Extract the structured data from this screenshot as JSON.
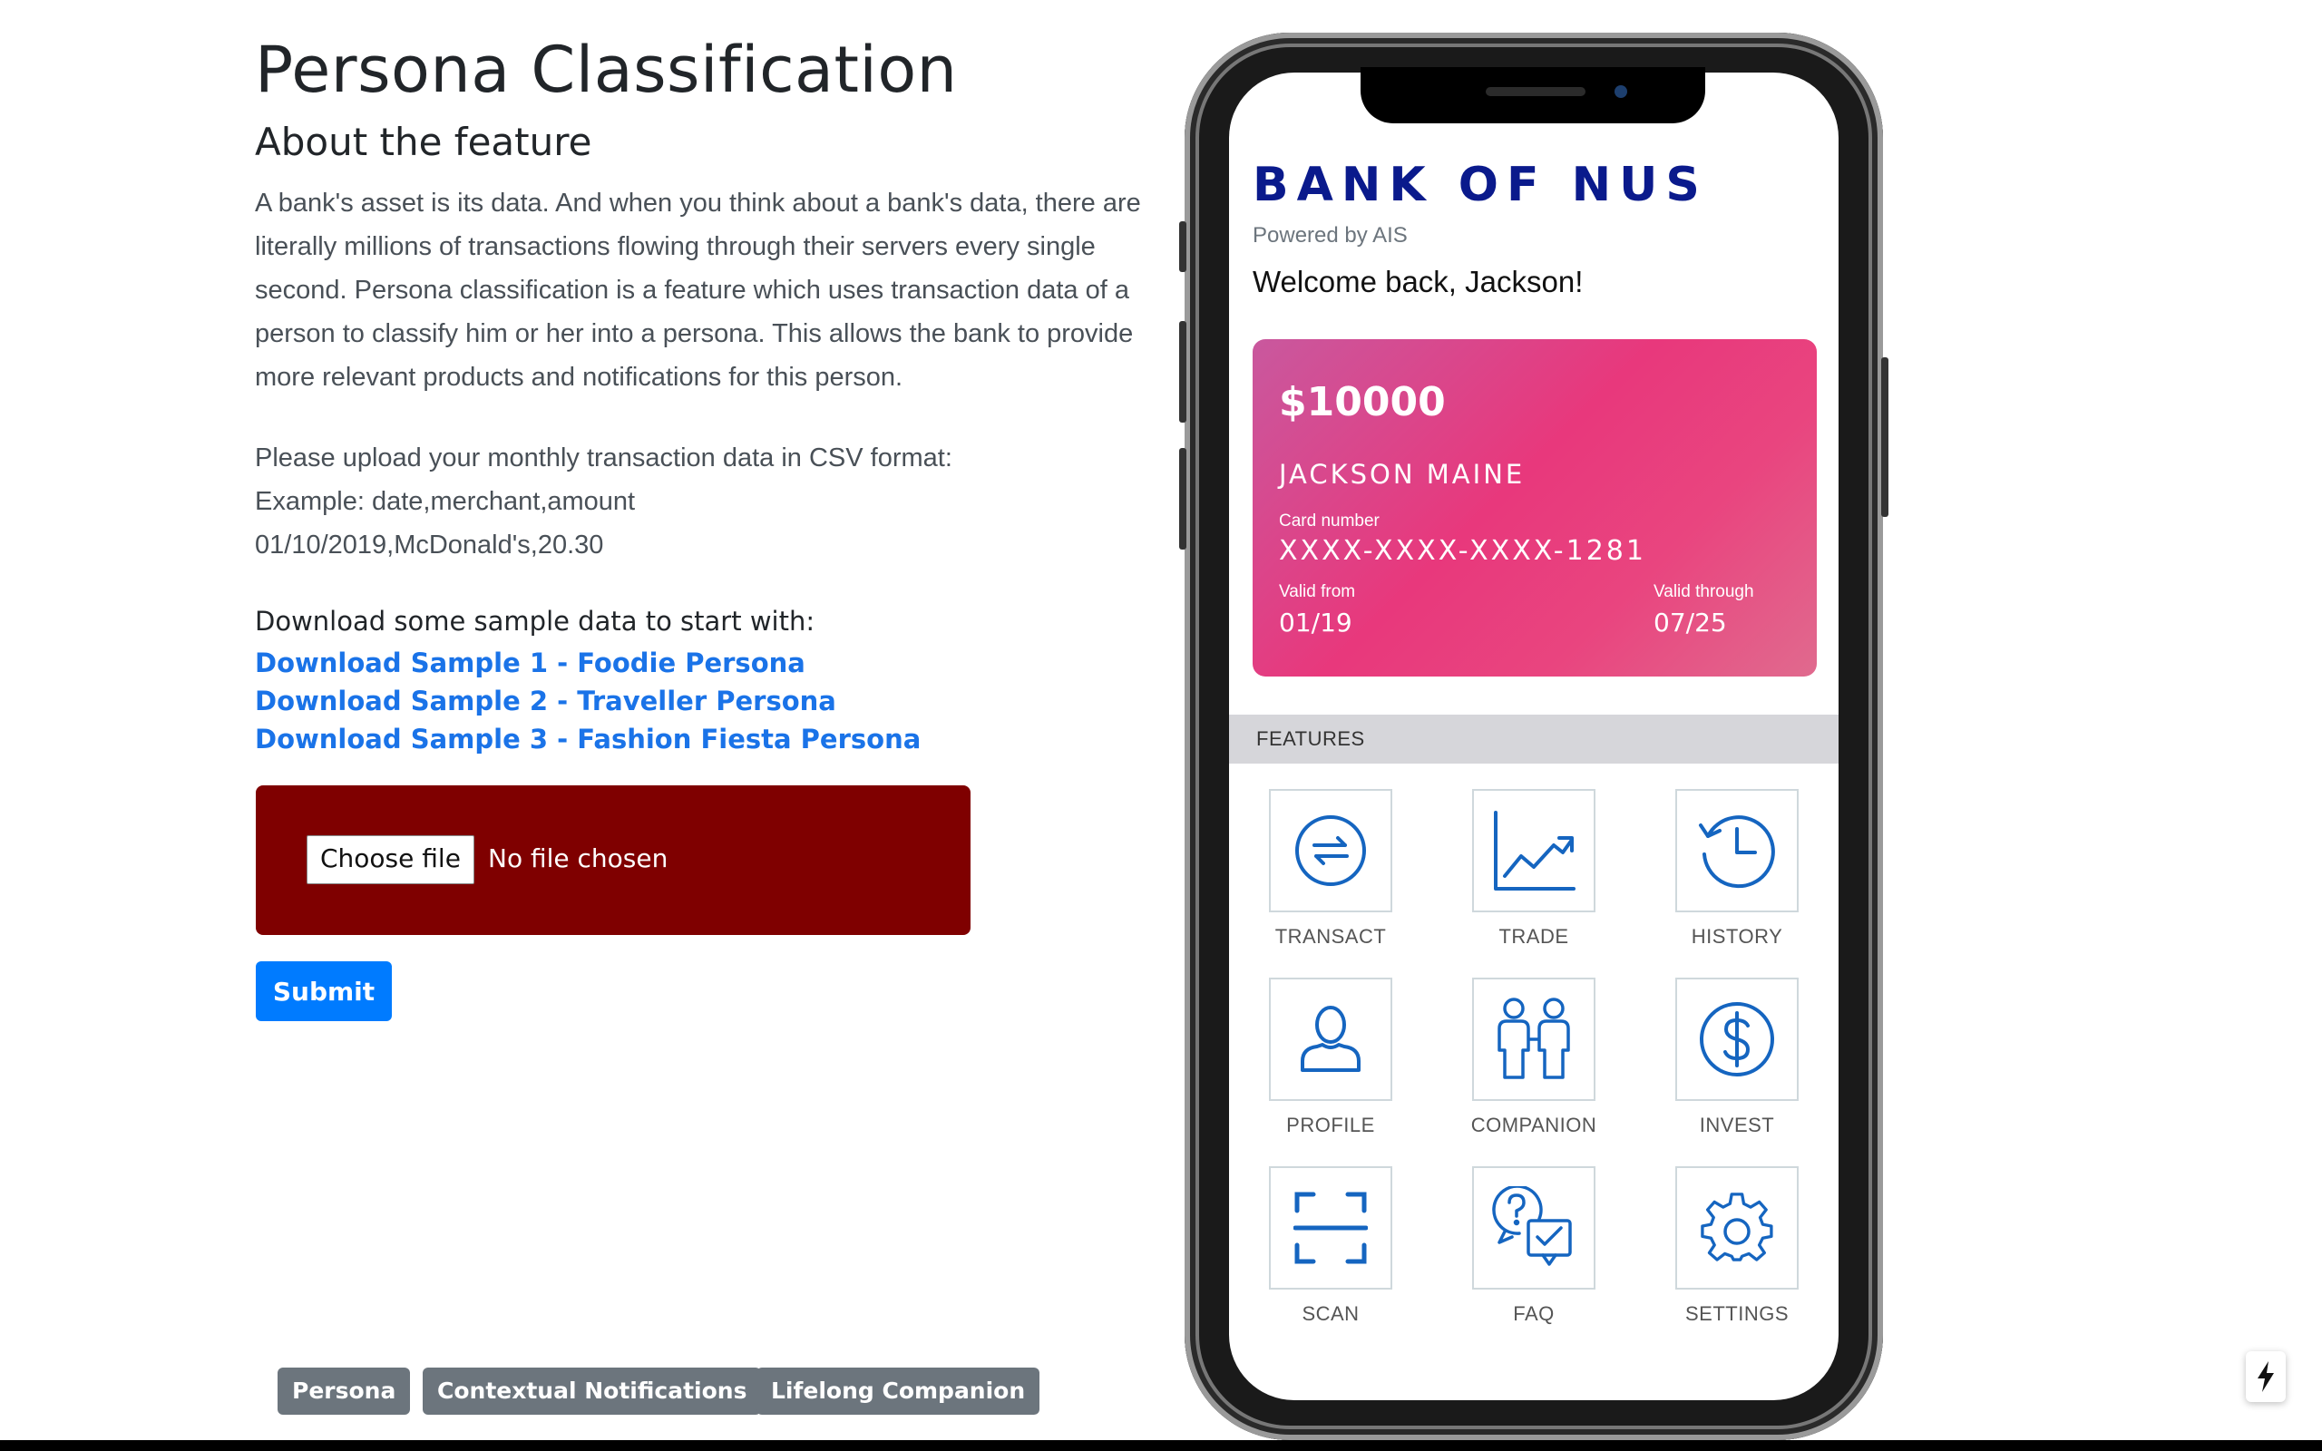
{
  "page": {
    "title": "Persona Classification",
    "subtitle": "About the feature",
    "about_text": "A bank's asset is its data. And when you think about a bank's data, there are literally millions of transactions flowing through their servers every single second. Persona classification is a feature which uses transaction data of a person to classify him or her into a persona. This allows the bank to provide more relevant products and notifications for this person.",
    "upload_lines": [
      "Please upload your monthly transaction data in CSV format:",
      "Example: date,merchant,amount",
      "01/10/2019,McDonald's,20.30"
    ],
    "download_heading": "Download some sample data to start with:",
    "download_links": [
      "Download Sample 1 - Foodie Persona",
      "Download Sample 2 - Traveller Persona",
      "Download Sample 3 - Fashion Fiesta Persona"
    ],
    "file_input": {
      "button_label": "Choose file",
      "status": "No file chosen"
    },
    "submit_label": "Submit",
    "pills": [
      "Persona",
      "Contextual Notifications",
      "Lifelong Companion"
    ]
  },
  "phone": {
    "bank_name": "BANK OF NUS",
    "powered_by": "Powered by AIS",
    "welcome": "Welcome back, Jackson!",
    "card": {
      "balance": "$10000",
      "holder": "JACKSON MAINE",
      "card_number_label": "Card number",
      "card_number": "XXXX-XXXX-XXXX-1281",
      "valid_from_label": "Valid from",
      "valid_from": "01/19",
      "valid_through_label": "Valid through",
      "valid_through": "07/25"
    },
    "features_heading": "FEATURES",
    "features": [
      {
        "label": "TRANSACT",
        "icon": "transact-arrows-icon"
      },
      {
        "label": "TRADE",
        "icon": "trade-chart-icon"
      },
      {
        "label": "HISTORY",
        "icon": "history-clock-icon"
      },
      {
        "label": "PROFILE",
        "icon": "profile-person-icon"
      },
      {
        "label": "COMPANION",
        "icon": "companion-people-icon"
      },
      {
        "label": "INVEST",
        "icon": "invest-dollar-icon"
      },
      {
        "label": "SCAN",
        "icon": "scan-frame-icon"
      },
      {
        "label": "FAQ",
        "icon": "faq-question-icon"
      },
      {
        "label": "SETTINGS",
        "icon": "settings-gear-icon"
      }
    ]
  },
  "colors": {
    "accent_link": "#1a73e8",
    "upload_box": "#7f0000",
    "submit_button": "#007bff",
    "bank_name": "#0a1a8c",
    "card_gradient_start": "#c9589e",
    "card_gradient_end": "#e8387c",
    "icon_stroke": "#1565c0"
  }
}
